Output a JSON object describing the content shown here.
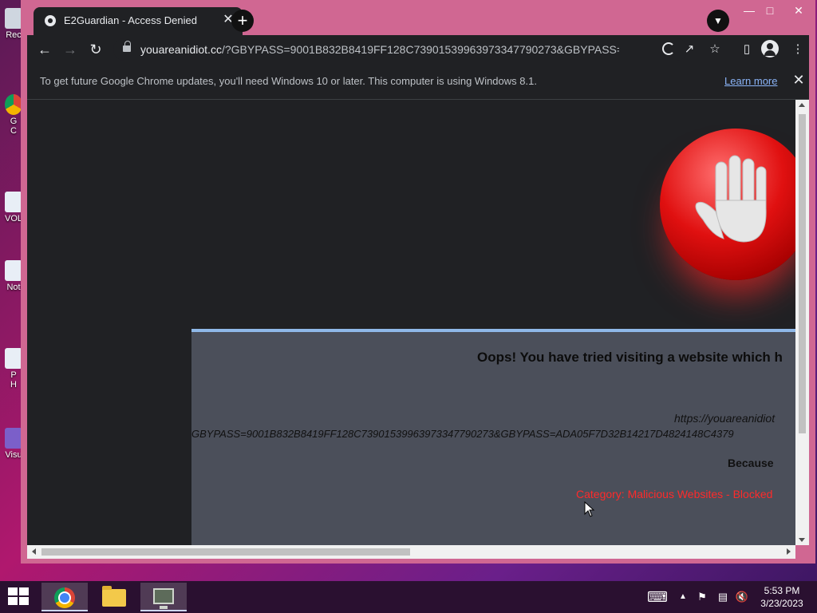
{
  "desktop": {
    "icons": [
      {
        "label": "Rec"
      },
      {
        "label": "G\nC"
      },
      {
        "label": "VOL"
      },
      {
        "label": "Not"
      },
      {
        "label": "P\nH"
      },
      {
        "label": "Visu"
      }
    ]
  },
  "browser": {
    "tab": {
      "title": "E2Guardian - Access Denied"
    },
    "address_bar": {
      "host": "youareanidiot.cc",
      "path": "/?GBYPASS=9001B832B8419FF128C7390153996397334779027​3&GBYPASS=ADA05F..."
    },
    "infobar": {
      "message": "To get future Google Chrome updates, you'll need Windows 10 or later. This computer is using Windows 8.1.",
      "link": "Learn more"
    }
  },
  "page": {
    "heading": "Oops! You have tried visiting a website which h",
    "blocked_url_line1": "https://youareanidiot",
    "blocked_url_line2": "GBYPASS=9001B832B8419FF128C73901539963973347790273&GBYPASS=ADA05F7D32B14217D4824148C4379",
    "because_label": "Because",
    "category": "Category: Malicious Websites - Blocked"
  },
  "taskbar": {
    "time": "5:53 PM",
    "date": "3/23/2023"
  },
  "colors": {
    "tab_bg": "#202124",
    "titlebar": "#d06792",
    "card": "#4b4f5a",
    "category_red": "#ff2a2a"
  }
}
